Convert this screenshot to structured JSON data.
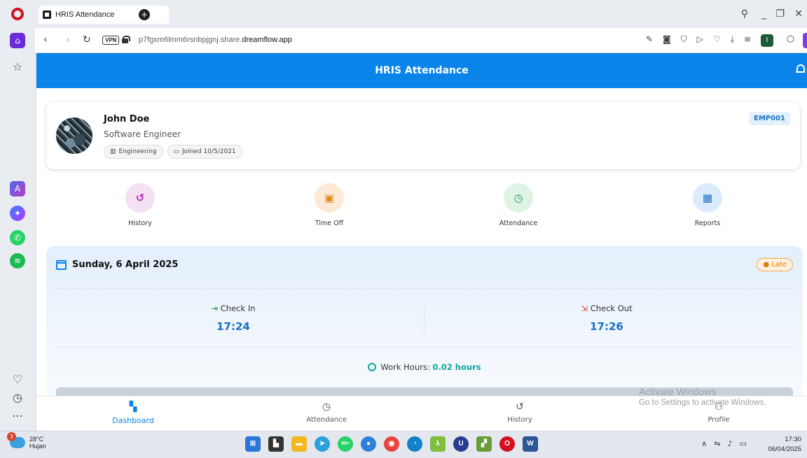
{
  "browser": {
    "tab_title": "HRIS Attendance",
    "new_tab_glyph": "+",
    "url_prefix": "p7fgxm6lmm6rsnbpjgnj.share.",
    "url_domain": "dreamflow.app",
    "vpn_label": "VPN",
    "profile_initial": "I"
  },
  "app": {
    "title": "HRIS Attendance",
    "accent_color": "#0a84e8",
    "employee": {
      "name": "John Doe",
      "role": "Software Engineer",
      "department": "Engineering",
      "joined": "Joined 10/5/2021",
      "id": "EMP001"
    },
    "quick_actions": [
      {
        "label": "History",
        "icon": "history-icon"
      },
      {
        "label": "Time Off",
        "icon": "calendar-check-icon"
      },
      {
        "label": "Attendance",
        "icon": "clock-icon"
      },
      {
        "label": "Reports",
        "icon": "chart-icon"
      }
    ],
    "attendance": {
      "date": "Sunday, 6 April 2025",
      "status": "Late",
      "check_in_label": "Check In",
      "check_in_time": "17:24",
      "check_out_label": "Check Out",
      "check_out_time": "17:26",
      "work_hours_label": "Work Hours:",
      "work_hours_value": "0.02 hours"
    },
    "bottom_nav": [
      {
        "label": "Dashboard",
        "icon": "dashboard-icon",
        "active": true
      },
      {
        "label": "Attendance",
        "icon": "clock-icon",
        "active": false
      },
      {
        "label": "History",
        "icon": "history-icon",
        "active": false
      },
      {
        "label": "Profile",
        "icon": "person-icon",
        "active": false
      }
    ]
  },
  "watermark": {
    "line1": "Activate Windows",
    "line2": "Go to Settings to activate Windows."
  },
  "taskbar": {
    "weather_temp": "28°C",
    "weather_text": "Hujan",
    "weather_badge": "3",
    "time": "17:30",
    "date": "06/04/2025",
    "whatsapp_badge": "99+"
  }
}
